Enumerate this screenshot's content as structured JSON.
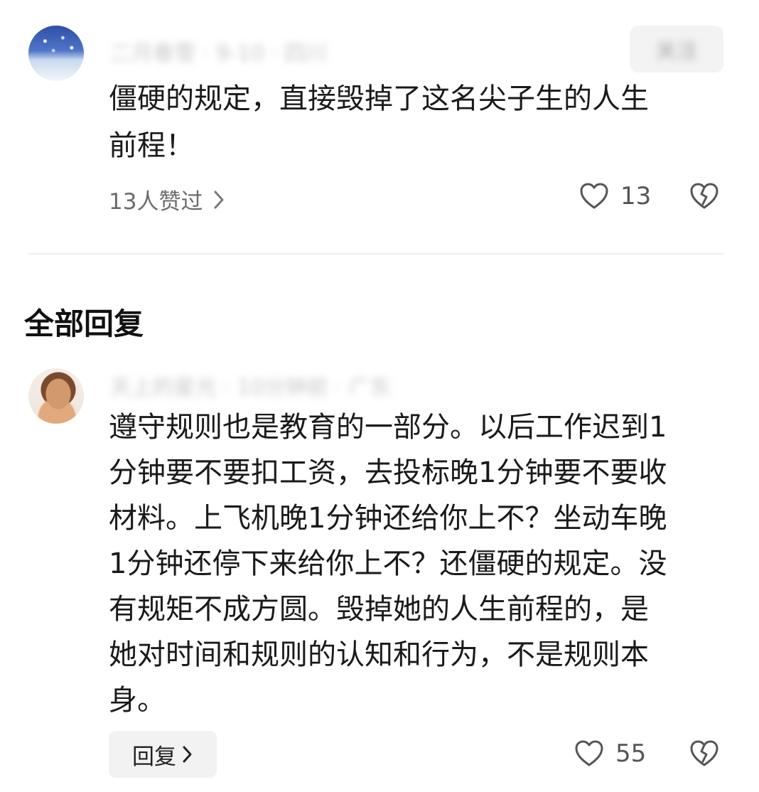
{
  "top_comment": {
    "author_blurred": "二月春雪 · 9-10 · 四川",
    "follow_label": "关注",
    "text_lines": [
      "僵硬的规定，直接毁掉了这名尖子生的人生",
      "前程！"
    ],
    "likers_label": "13人赞过",
    "like_count": "13"
  },
  "section": {
    "title": "全部回复"
  },
  "reply": {
    "author_blurred": "天上的星光 · 10分钟前 · 广东",
    "text_lines": [
      "遵守规则也是教育的一部分。以后工作迟到1",
      "分钟要不要扣工资，去投标晚1分钟要不要收",
      "材料。上飞机晚1分钟还给你上不？坐动车晚",
      "1分钟还停下来给你上不？还僵硬的规定。没",
      "有规矩不成方圆。毁掉她的人生前程的，是",
      "她对时间和规则的认知和行为，不是规则本",
      "身。"
    ],
    "reply_label": "回复",
    "like_count": "55"
  }
}
